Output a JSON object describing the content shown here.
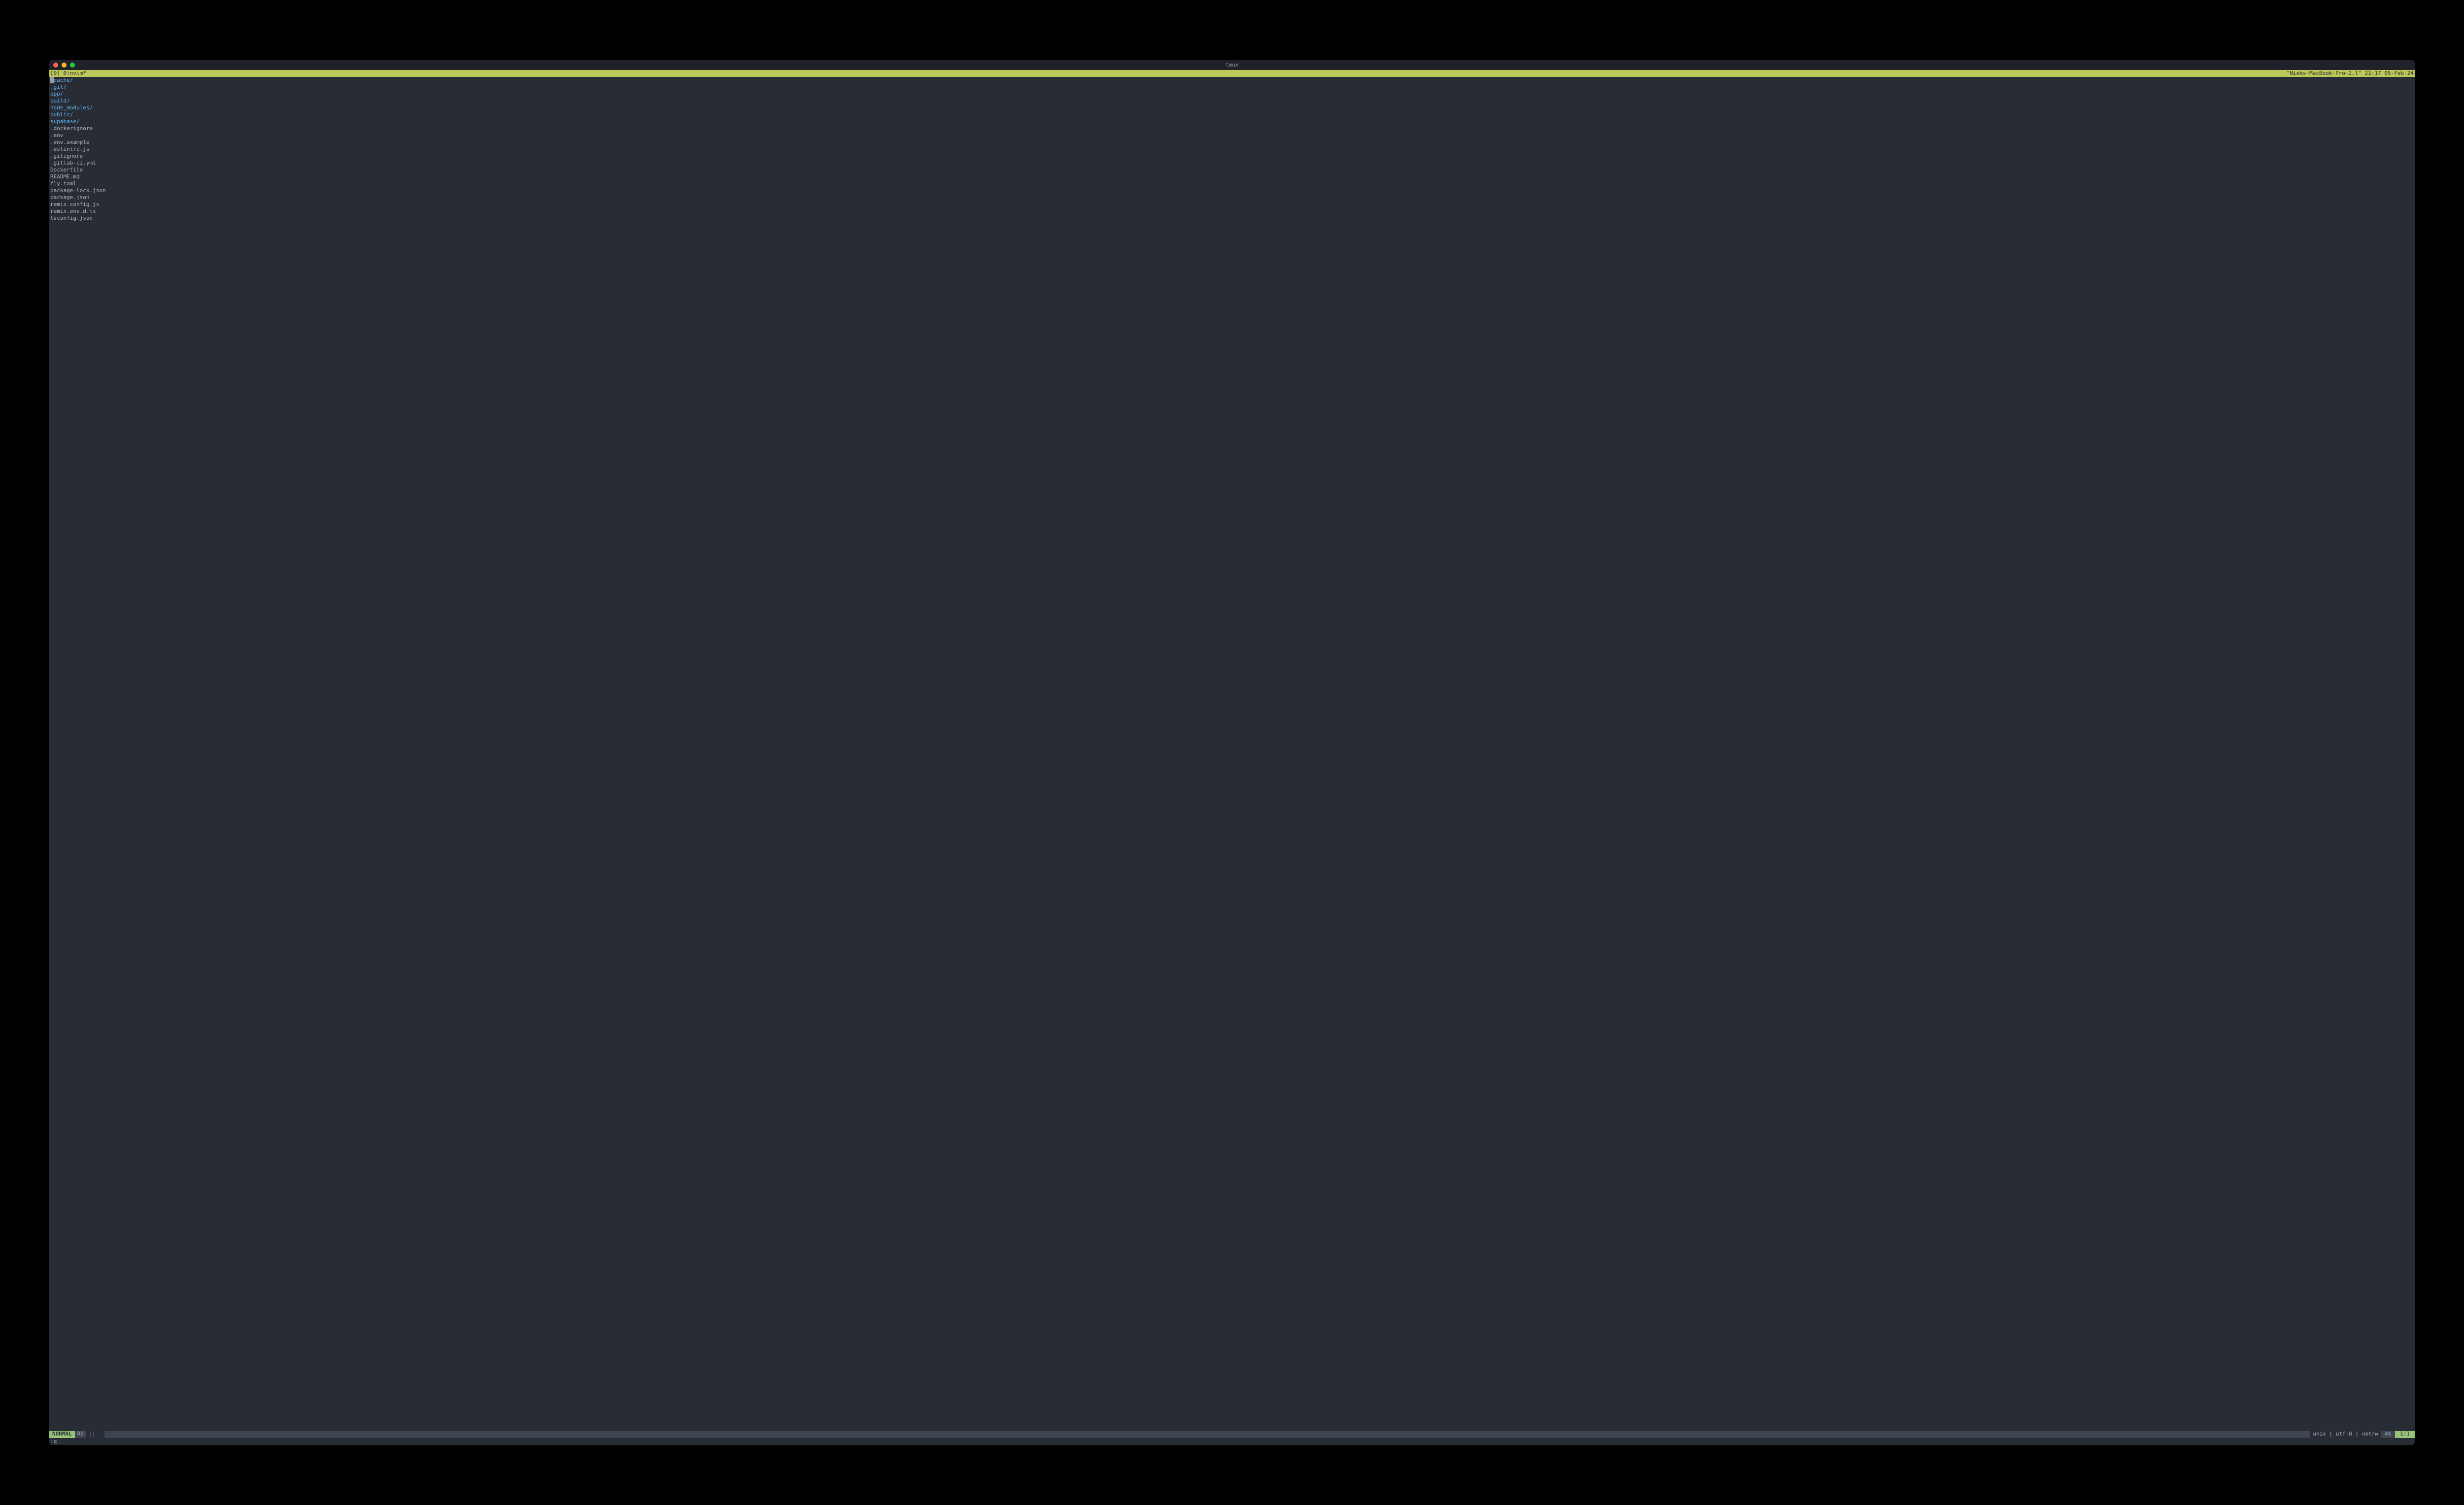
{
  "window": {
    "title": "tmux"
  },
  "tmux": {
    "left": "[0] 0:nvim*",
    "right": "\"Nieks-MacBook-Pro-2.l\" 21:17 05-Feb-24"
  },
  "netrw": {
    "cursor_char": ".",
    "cursor_rest": "cache/",
    "entries": [
      {
        "name": ".git/",
        "type": "dir"
      },
      {
        "name": "app/",
        "type": "dir"
      },
      {
        "name": "build/",
        "type": "dir"
      },
      {
        "name": "node_modules/",
        "type": "dir"
      },
      {
        "name": "public/",
        "type": "dir"
      },
      {
        "name": "supabase/",
        "type": "dir"
      },
      {
        "name": ".dockerignore",
        "type": "file"
      },
      {
        "name": ".env",
        "type": "file"
      },
      {
        "name": ".env.example",
        "type": "file"
      },
      {
        "name": ".eslintrc.js",
        "type": "file"
      },
      {
        "name": ".gitignore",
        "type": "file"
      },
      {
        "name": ".gitlab-ci.yml",
        "type": "file"
      },
      {
        "name": "Dockerfile",
        "type": "file"
      },
      {
        "name": "README.md",
        "type": "file"
      },
      {
        "name": "fly.toml",
        "type": "file"
      },
      {
        "name": "package-lock.json",
        "type": "file"
      },
      {
        "name": "package.json",
        "type": "file"
      },
      {
        "name": "remix.config.js",
        "type": "file"
      },
      {
        "name": "remix.env.d.ts",
        "type": "file"
      },
      {
        "name": "tsconfig.json",
        "type": "file"
      }
    ]
  },
  "statusline": {
    "mode": "NORMAL",
    "ro": "RO",
    "branch": "|| -",
    "encoding": "unix | utf-8 | netrw",
    "percent": "4%",
    "position": "1:1"
  },
  "cmdline": ":q"
}
